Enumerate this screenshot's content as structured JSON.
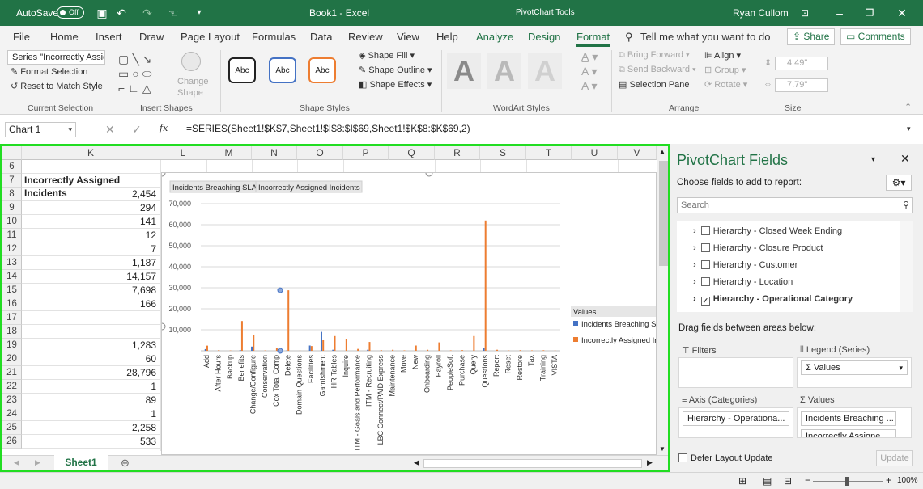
{
  "titlebar": {
    "autosave": "AutoSave",
    "toggle": "Off",
    "doc": "Book1  -  Excel",
    "tools": "PivotChart Tools",
    "user": "Ryan Cullom"
  },
  "menu": {
    "items": [
      "File",
      "Home",
      "Insert",
      "Draw",
      "Page Layout",
      "Formulas",
      "Data",
      "Review",
      "View",
      "Help",
      "Analyze",
      "Design",
      "Format"
    ],
    "tell": "Tell me what you want to do",
    "share": "Share",
    "comments": "Comments"
  },
  "ribbon": {
    "current_selection": {
      "dropdown": "Series \"Incorrectly Assig",
      "format": "Format Selection",
      "reset": "Reset to Match Style",
      "label": "Current Selection"
    },
    "insert_shapes": {
      "change": "Change",
      "shape": "Shape",
      "label": "Insert Shapes"
    },
    "shape_styles": {
      "sample": "Abc",
      "fill": "Shape Fill",
      "outline": "Shape Outline",
      "effects": "Shape Effects",
      "label": "Shape Styles"
    },
    "wordart": {
      "letter": "A",
      "label": "WordArt Styles"
    },
    "arrange": {
      "forward": "Bring Forward",
      "backward": "Send Backward",
      "selection": "Selection Pane",
      "align": "Align",
      "group": "Group",
      "rotate": "Rotate",
      "label": "Arrange"
    },
    "size": {
      "height": "4.49\"",
      "width": "7.79\"",
      "label": "Size"
    }
  },
  "formulabar": {
    "namebox": "Chart 1",
    "fx": "fx",
    "formula": "=SERIES(Sheet1!$K$7,Sheet1!$I$8:$I$69,Sheet1!$K$8:$K$69,2)"
  },
  "sheet": {
    "columns": [
      "K",
      "L",
      "M",
      "N",
      "O",
      "P",
      "Q",
      "R",
      "S",
      "T",
      "U",
      "V"
    ],
    "rows": [
      6,
      7,
      8,
      9,
      10,
      11,
      12,
      13,
      14,
      15,
      16,
      17,
      18,
      19,
      20,
      21,
      22,
      23,
      24,
      25,
      26
    ],
    "k_values": [
      "",
      "Incorrectly Assigned Incidents",
      "2,454",
      "294",
      "141",
      "12",
      "7",
      "1,187",
      "14,157",
      "7,698",
      "166",
      "",
      "",
      "1,283",
      "60",
      "28,796",
      "1",
      "89",
      "1",
      "2,258",
      "533"
    ],
    "tab": "Sheet1"
  },
  "chart_data": {
    "type": "bar",
    "field_buttons": [
      "Incidents Breaching SLA",
      "Incorrectly Assigned Incidents"
    ],
    "ylim": [
      0,
      70000
    ],
    "yticks": [
      "70,000",
      "60,000",
      "50,000",
      "40,000",
      "30,000",
      "20,000",
      "10,000",
      ""
    ],
    "categories": [
      "Add",
      "After Hours",
      "Backup",
      "Benefits",
      "Change/Configure",
      "Conservation",
      "Cox Total Comp",
      "Delete",
      "Domain Questions",
      "Facilities",
      "Garnishment",
      "HR Tables",
      "Inquire",
      "ITM - Goals and Performance",
      "ITM - Recruiting",
      "LBC Connect/PAID Express",
      "Maintenance",
      "Move",
      "New",
      "Onboarding",
      "Payroll",
      "PeopleSoft",
      "Purchase",
      "Query",
      "Questions",
      "Report",
      "Reset",
      "Restore",
      "Tax",
      "Training",
      "VISTA"
    ],
    "series": [
      {
        "name": "Incidents Breaching SLA",
        "color": "#4472c4",
        "values": [
          800,
          0,
          0,
          300,
          2000,
          0,
          0,
          100,
          0,
          2500,
          9000,
          500,
          0,
          0,
          500,
          0,
          0,
          0,
          0,
          0,
          0,
          0,
          0,
          0,
          1500,
          0,
          0,
          0,
          0,
          0,
          0
        ]
      },
      {
        "name": "Incorrectly Assigned Incidents",
        "color": "#ed7d31",
        "values": [
          2454,
          294,
          141,
          14157,
          7698,
          166,
          1283,
          28796,
          60,
          2258,
          5000,
          7000,
          5500,
          900,
          4200,
          300,
          500,
          200,
          2500,
          500,
          4000,
          200,
          300,
          7000,
          62000,
          500,
          150,
          300,
          200,
          250,
          100
        ]
      }
    ],
    "legend_title": "Values"
  },
  "pane": {
    "title": "PivotChart Fields",
    "subtitle": "Choose fields to add to report:",
    "search": "Search",
    "fields": [
      {
        "label": "Hierarchy - Closed Week Ending",
        "checked": false
      },
      {
        "label": "Hierarchy - Closure Product",
        "checked": false
      },
      {
        "label": "Hierarchy - Customer",
        "checked": false
      },
      {
        "label": "Hierarchy - Location",
        "checked": false
      },
      {
        "label": "Hierarchy - Operational Category",
        "checked": true
      }
    ],
    "drag": "Drag fields between areas below:",
    "filters": "Filters",
    "legend": "Legend (Series)",
    "legend_value": "Σ Values",
    "axis": "Axis (Categories)",
    "axis_value": "Hierarchy - Operationa...",
    "values": "Values",
    "value1": "Incidents Breaching ...",
    "value2": "Incorrectly Assigne...",
    "defer": "Defer Layout Update",
    "update": "Update"
  },
  "status": {
    "zoom": "100%"
  }
}
